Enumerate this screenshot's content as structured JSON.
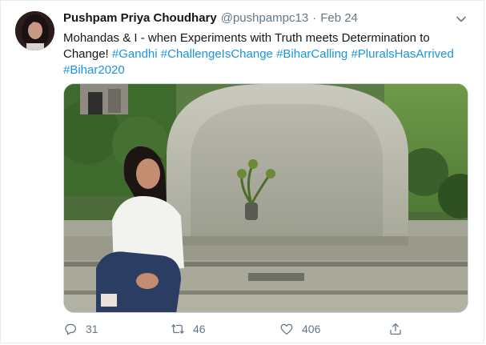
{
  "tweet": {
    "author_name": "Pushpam Priya Choudhary",
    "handle": "@pushpampc13",
    "separator": "·",
    "date": "Feb 24",
    "text_main": "Mohandas & I - when Experiments with Truth meets Determination to Change! ",
    "hashtags": [
      "#Gandhi",
      "#ChallengeIsChange",
      "#BiharCalling",
      "#PluralsHasArrived",
      "#Bihar2020"
    ],
    "replies": "31",
    "retweets": "46",
    "likes": "406"
  },
  "icons": {
    "menu": "chevron-down-icon",
    "reply": "reply-icon",
    "retweet": "retweet-icon",
    "like": "heart-icon",
    "share": "share-icon"
  },
  "colors": {
    "link": "#1b95e0",
    "muted": "#657786",
    "text": "#14171a",
    "border": "#e6ecf0"
  }
}
